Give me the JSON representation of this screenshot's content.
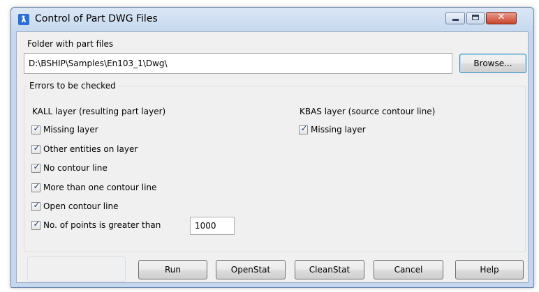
{
  "window": {
    "title": "Control of Part DWG Files",
    "icon": "app-logo-icon",
    "controls": {
      "minimize": "minimize-icon",
      "maximize": "maximize-icon",
      "close": "close-icon"
    }
  },
  "folder": {
    "label": "Folder with part files",
    "path": "D:\\BSHIP\\Samples\\En103_1\\Dwg\\",
    "browse_label": "Browse..."
  },
  "errors": {
    "group_label": "Errors to be checked",
    "kall": {
      "heading": "KALL layer (resulting part layer)",
      "items": [
        {
          "label": "Missing layer",
          "checked": true
        },
        {
          "label": "Other entities on layer",
          "checked": true
        },
        {
          "label": "No contour line",
          "checked": true
        },
        {
          "label": "More than one contour line",
          "checked": true
        },
        {
          "label": "Open contour line",
          "checked": true
        },
        {
          "label": "No. of points is greater than",
          "checked": true
        }
      ],
      "points_value": "1000"
    },
    "kbas": {
      "heading": "KBAS layer (source contour line)",
      "items": [
        {
          "label": "Missing layer",
          "checked": true
        }
      ]
    }
  },
  "buttons": {
    "run": "Run",
    "openstat": "OpenStat",
    "cleanstat": "CleanStat",
    "cancel": "Cancel",
    "help": "Help"
  },
  "colors": {
    "titlebar": "#c6d9ef",
    "client": "#f0f0f0",
    "check": "#1d3a7a",
    "close_button": "#c9432c"
  }
}
